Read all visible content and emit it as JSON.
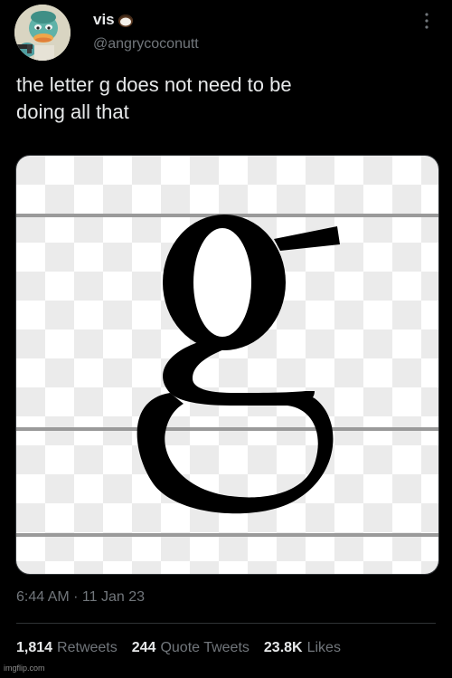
{
  "author": {
    "display_name": "vis",
    "display_emoji": "coconut-icon",
    "handle": "@angrycoconutt",
    "avatar": "duck-character-avatar"
  },
  "tweet": {
    "text": "the letter g does not need to be\ndoing all that",
    "media_glyph": "g",
    "timestamp": "6:44 AM · 11 Jan 23"
  },
  "stats": {
    "retweets_count": "1,814",
    "retweets_label": "Retweets",
    "quote_count": "244",
    "quote_label": "Quote Tweets",
    "likes_count": "23.8K",
    "likes_label": "Likes"
  },
  "watermark": "imgflip.com",
  "colors": {
    "background": "#000000",
    "primary_text": "#e7e9ea",
    "secondary_text": "#71767b",
    "divider": "#2f3336"
  },
  "icons": [
    "more-icon",
    "coconut-icon"
  ]
}
